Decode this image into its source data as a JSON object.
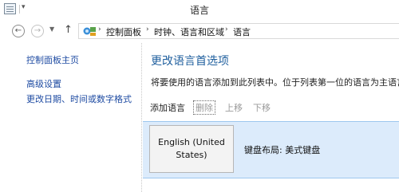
{
  "window": {
    "title": "语言"
  },
  "address": {
    "crumbs": [
      "控制面板",
      "时钟、语言和区域",
      "语言"
    ]
  },
  "left_pane": {
    "links": [
      "控制面板主页",
      "高级设置",
      "更改日期、时间或数字格式"
    ]
  },
  "main": {
    "heading": "更改语言首选项",
    "description": "将要使用的语言添加到此列表中。位于列表第一位的语言为主语言(即"
  },
  "toolbar": {
    "add": "添加语言",
    "remove": "删除",
    "move_up": "上移",
    "move_down": "下移"
  },
  "languages": [
    {
      "name": "English (United States)",
      "keyboard": "键盘布局: 美式键盘"
    }
  ]
}
